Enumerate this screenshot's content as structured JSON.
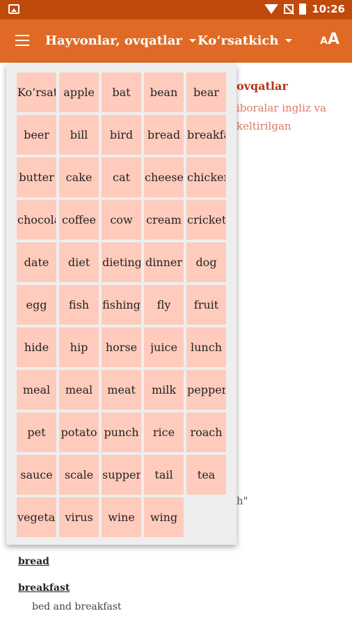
{
  "status_bar": {
    "time": "10:26",
    "icons": [
      "image-icon",
      "wifi-icon",
      "no-signal-icon",
      "battery-icon"
    ]
  },
  "app_bar": {
    "menu_icon": "hamburger-icon",
    "category_dropdown": "Hayvonlar, ovqatlar",
    "index_dropdown": "Ko‘rsatkich",
    "font_size_icon": "font-size-icon"
  },
  "background": {
    "title_fragment": "ovqatlar",
    "description_fragment_1": "iboralar ingliz va",
    "description_fragment_2": "keltirilgan",
    "quote_fragment": "h\"",
    "entries": [
      {
        "title": "bread"
      },
      {
        "title": "breakfast",
        "sub": "bed and breakfast"
      }
    ]
  },
  "index_popup": {
    "cells": [
      "Ko‘rsatkich",
      "apple",
      "bat",
      "bean",
      "bear",
      "beer",
      "bill",
      "bird",
      "bread",
      "breakfast",
      "butter",
      "cake",
      "cat",
      "cheese",
      "chicken",
      "chocolate",
      "coffee",
      "cow",
      "cream",
      "cricket",
      "date",
      "diet",
      "dieting",
      "dinner",
      "dog",
      "egg",
      "fish",
      "fishing",
      "fly",
      "fruit",
      "hide",
      "hip",
      "horse",
      "juice",
      "lunch",
      "meal",
      "meal",
      "meat",
      "milk",
      "pepper",
      "pet",
      "potato",
      "punch",
      "rice",
      "roach",
      "sauce",
      "scale",
      "supper",
      "tail",
      "tea",
      "vegetable",
      "virus",
      "wine",
      "wing"
    ]
  },
  "colors": {
    "status_bar": "#bf4a0c",
    "app_bar": "#e06a25",
    "cell": "#ffcbbc",
    "popup": "#eeeeee",
    "accent_text": "#b5361a"
  }
}
